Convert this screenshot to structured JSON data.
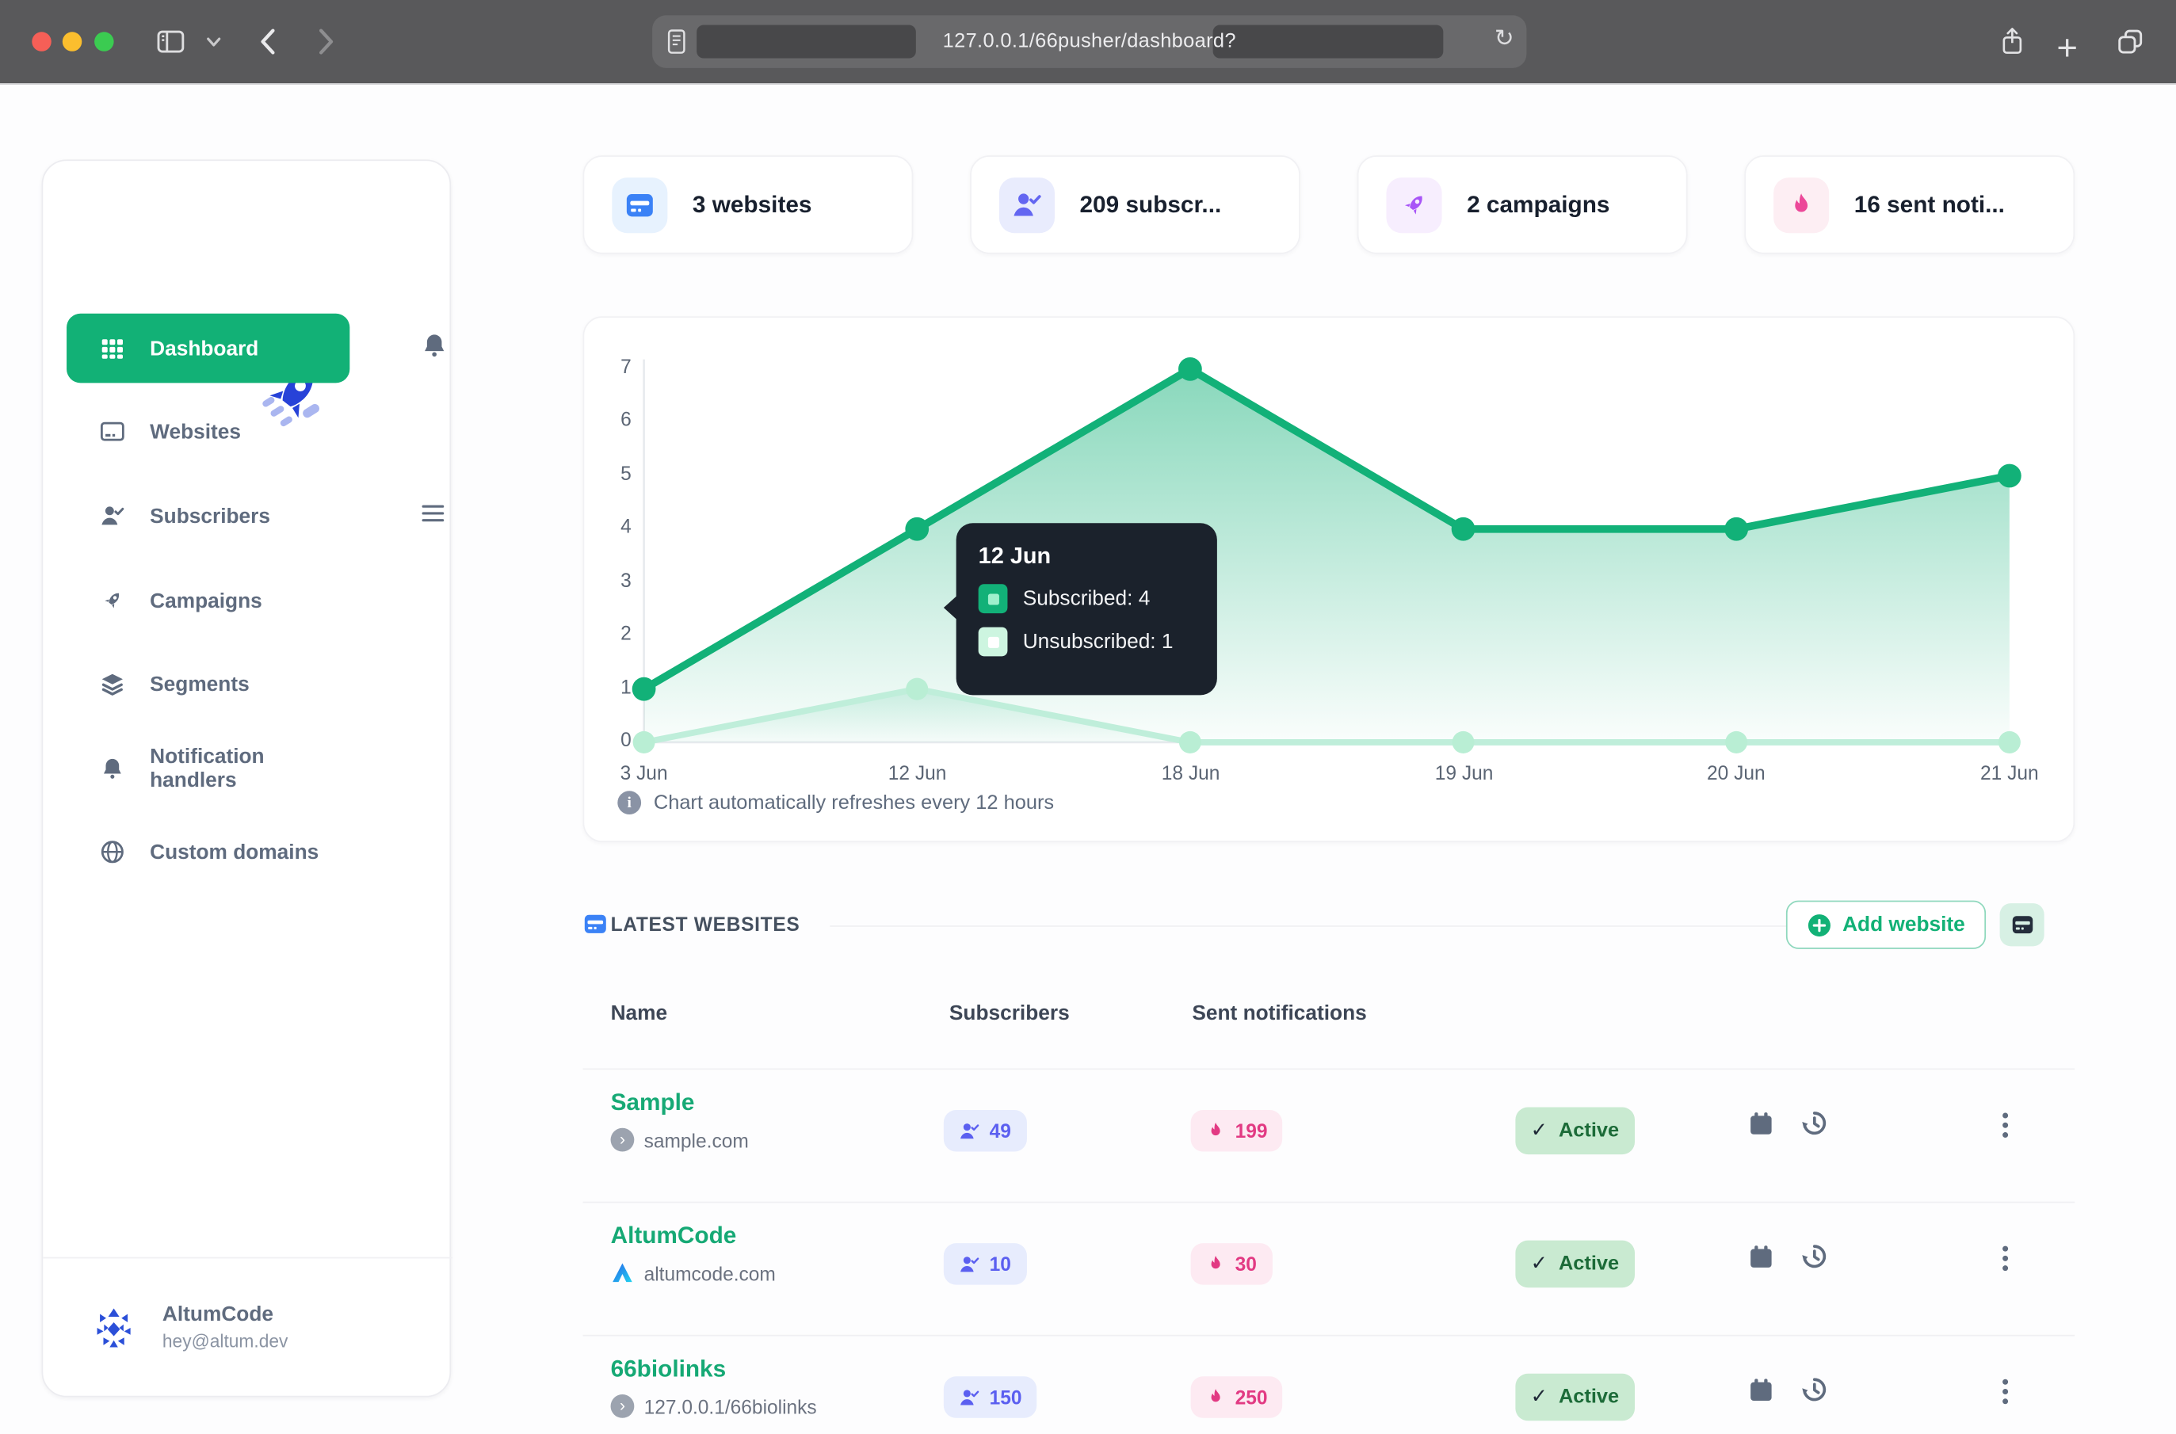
{
  "browser": {
    "url": "127.0.0.1/66pusher/dashboard?"
  },
  "sidebar": {
    "nav": [
      {
        "label": "Dashboard",
        "active": true
      },
      {
        "label": "Websites"
      },
      {
        "label": "Subscribers"
      },
      {
        "label": "Campaigns"
      },
      {
        "label": "Segments"
      },
      {
        "label": "Notification handlers"
      },
      {
        "label": "Custom domains"
      }
    ],
    "user": {
      "name": "AltumCode",
      "email": "hey@altum.dev"
    }
  },
  "stats": [
    {
      "icon": "browser-card-icon",
      "label": "3 websites"
    },
    {
      "icon": "user-check-icon",
      "label": "209 subscr..."
    },
    {
      "icon": "rocket-icon",
      "label": "2 campaigns"
    },
    {
      "icon": "flame-icon",
      "label": "16 sent noti..."
    }
  ],
  "chart_data": {
    "type": "area",
    "categories": [
      "3 Jun",
      "12 Jun",
      "18 Jun",
      "19 Jun",
      "20 Jun",
      "21 Jun"
    ],
    "series": [
      {
        "name": "Subscribed",
        "values": [
          1,
          4,
          7,
          4,
          4,
          5
        ],
        "color": "#12b178"
      },
      {
        "name": "Unsubscribed",
        "values": [
          0,
          1,
          0,
          0,
          0,
          0
        ],
        "color": "#b9eed4"
      }
    ],
    "ylim": [
      0,
      7
    ],
    "y_ticks": [
      "7",
      "6",
      "5",
      "4",
      "3",
      "2",
      "1",
      "0"
    ],
    "grid": false,
    "legend_position": "none",
    "note": "Chart automatically refreshes every 12 hours",
    "tooltip": {
      "title": "12 Jun",
      "rows": [
        "Subscribed: 4",
        "Unsubscribed: 1"
      ]
    }
  },
  "latest_websites": {
    "title": "LATEST WEBSITES",
    "add_button": "Add website",
    "table": {
      "headers": [
        "Name",
        "Subscribers",
        "Sent notifications"
      ],
      "rows": [
        {
          "name": "Sample",
          "domain": "sample.com",
          "subscribers": "49",
          "sent_notifications": "199",
          "status": "Active"
        },
        {
          "name": "AltumCode",
          "domain": "altumcode.com",
          "subscribers": "10",
          "sent_notifications": "30",
          "status": "Active"
        },
        {
          "name": "66biolinks",
          "domain": "127.0.0.1/66biolinks",
          "subscribers": "150",
          "sent_notifications": "250",
          "status": "Active"
        }
      ]
    }
  },
  "colors": {
    "accent_green": "#12b176",
    "indigo": "#6366f1",
    "blue": "#3b82f6",
    "purple": "#a855f7",
    "pink": "#ec4899",
    "tooltip_bg": "#1b222c"
  }
}
